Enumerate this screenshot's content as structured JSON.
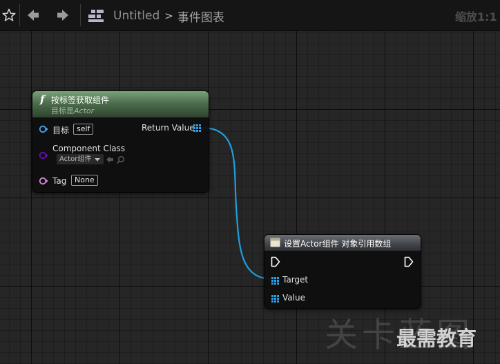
{
  "toolbar": {
    "favorite_icon": "star-outline-icon",
    "back_icon": "arrow-left-icon",
    "forward_icon": "arrow-right-icon",
    "graph_icon": "event-graph-icon",
    "breadcrumb": {
      "root": "Untitled",
      "separator": ">",
      "current": "事件图表"
    },
    "zoom_label": "缩放1:1"
  },
  "nodes": {
    "get_components_by_tag": {
      "title": "按标签获取组件",
      "subtitle_prefix": "目标是",
      "subtitle_class": "Actor",
      "header_color": "#5f8a5f",
      "pins": {
        "target": {
          "label": "目标",
          "default": "self",
          "color": "#3fa9f5"
        },
        "component_class": {
          "label": "Component Class",
          "default": "Actor组件",
          "color": "#6a0dbd"
        },
        "tag": {
          "label": "Tag",
          "default": "None",
          "color": "#d58ad9"
        },
        "return_value": {
          "label": "Return Value",
          "color": "#2aa0e6"
        }
      }
    },
    "set_actor_component_array": {
      "title": "设置Actor组件 对象引用数组",
      "pins": {
        "target": {
          "label": "Target"
        },
        "value": {
          "label": "Value"
        }
      }
    }
  },
  "wire_color": "#1f9fdf",
  "watermark": {
    "big": "关卡蓝图",
    "small": "最需教育"
  }
}
